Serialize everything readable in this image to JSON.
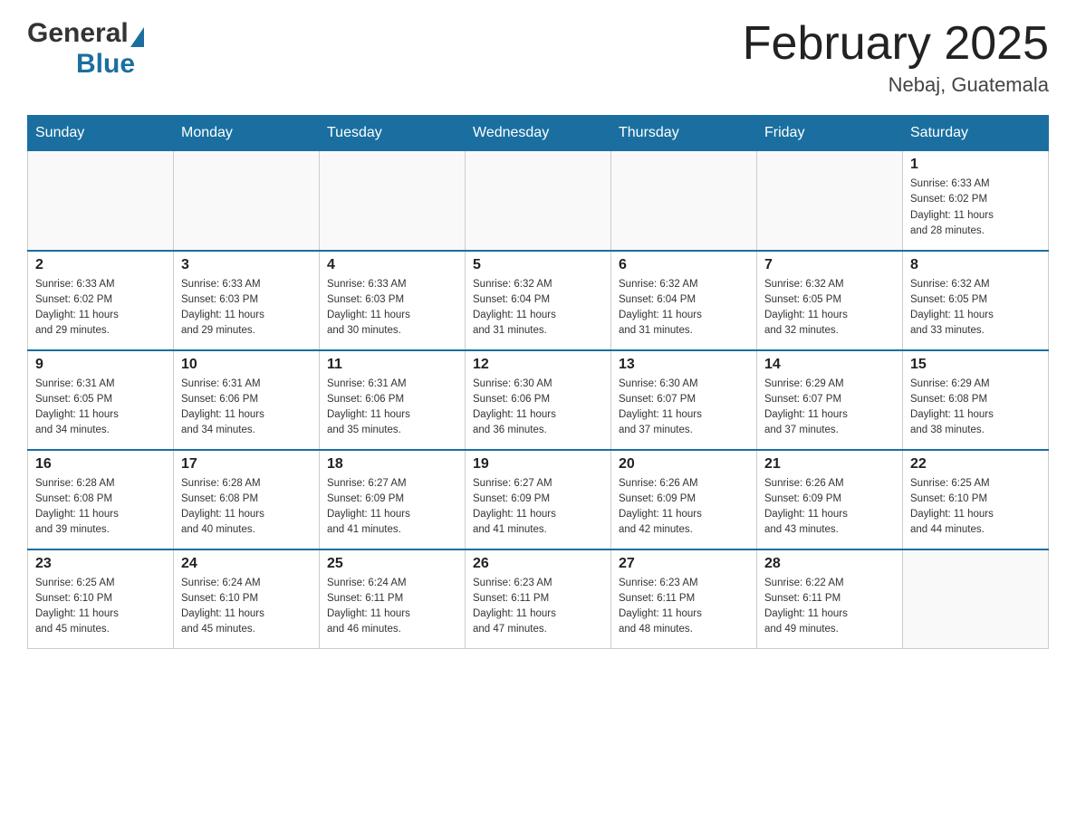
{
  "header": {
    "logo": {
      "general": "General",
      "blue": "Blue"
    },
    "title": "February 2025",
    "location": "Nebaj, Guatemala"
  },
  "calendar": {
    "days_of_week": [
      "Sunday",
      "Monday",
      "Tuesday",
      "Wednesday",
      "Thursday",
      "Friday",
      "Saturday"
    ],
    "weeks": [
      [
        {
          "day": "",
          "info": ""
        },
        {
          "day": "",
          "info": ""
        },
        {
          "day": "",
          "info": ""
        },
        {
          "day": "",
          "info": ""
        },
        {
          "day": "",
          "info": ""
        },
        {
          "day": "",
          "info": ""
        },
        {
          "day": "1",
          "info": "Sunrise: 6:33 AM\nSunset: 6:02 PM\nDaylight: 11 hours\nand 28 minutes."
        }
      ],
      [
        {
          "day": "2",
          "info": "Sunrise: 6:33 AM\nSunset: 6:02 PM\nDaylight: 11 hours\nand 29 minutes."
        },
        {
          "day": "3",
          "info": "Sunrise: 6:33 AM\nSunset: 6:03 PM\nDaylight: 11 hours\nand 29 minutes."
        },
        {
          "day": "4",
          "info": "Sunrise: 6:33 AM\nSunset: 6:03 PM\nDaylight: 11 hours\nand 30 minutes."
        },
        {
          "day": "5",
          "info": "Sunrise: 6:32 AM\nSunset: 6:04 PM\nDaylight: 11 hours\nand 31 minutes."
        },
        {
          "day": "6",
          "info": "Sunrise: 6:32 AM\nSunset: 6:04 PM\nDaylight: 11 hours\nand 31 minutes."
        },
        {
          "day": "7",
          "info": "Sunrise: 6:32 AM\nSunset: 6:05 PM\nDaylight: 11 hours\nand 32 minutes."
        },
        {
          "day": "8",
          "info": "Sunrise: 6:32 AM\nSunset: 6:05 PM\nDaylight: 11 hours\nand 33 minutes."
        }
      ],
      [
        {
          "day": "9",
          "info": "Sunrise: 6:31 AM\nSunset: 6:05 PM\nDaylight: 11 hours\nand 34 minutes."
        },
        {
          "day": "10",
          "info": "Sunrise: 6:31 AM\nSunset: 6:06 PM\nDaylight: 11 hours\nand 34 minutes."
        },
        {
          "day": "11",
          "info": "Sunrise: 6:31 AM\nSunset: 6:06 PM\nDaylight: 11 hours\nand 35 minutes."
        },
        {
          "day": "12",
          "info": "Sunrise: 6:30 AM\nSunset: 6:06 PM\nDaylight: 11 hours\nand 36 minutes."
        },
        {
          "day": "13",
          "info": "Sunrise: 6:30 AM\nSunset: 6:07 PM\nDaylight: 11 hours\nand 37 minutes."
        },
        {
          "day": "14",
          "info": "Sunrise: 6:29 AM\nSunset: 6:07 PM\nDaylight: 11 hours\nand 37 minutes."
        },
        {
          "day": "15",
          "info": "Sunrise: 6:29 AM\nSunset: 6:08 PM\nDaylight: 11 hours\nand 38 minutes."
        }
      ],
      [
        {
          "day": "16",
          "info": "Sunrise: 6:28 AM\nSunset: 6:08 PM\nDaylight: 11 hours\nand 39 minutes."
        },
        {
          "day": "17",
          "info": "Sunrise: 6:28 AM\nSunset: 6:08 PM\nDaylight: 11 hours\nand 40 minutes."
        },
        {
          "day": "18",
          "info": "Sunrise: 6:27 AM\nSunset: 6:09 PM\nDaylight: 11 hours\nand 41 minutes."
        },
        {
          "day": "19",
          "info": "Sunrise: 6:27 AM\nSunset: 6:09 PM\nDaylight: 11 hours\nand 41 minutes."
        },
        {
          "day": "20",
          "info": "Sunrise: 6:26 AM\nSunset: 6:09 PM\nDaylight: 11 hours\nand 42 minutes."
        },
        {
          "day": "21",
          "info": "Sunrise: 6:26 AM\nSunset: 6:09 PM\nDaylight: 11 hours\nand 43 minutes."
        },
        {
          "day": "22",
          "info": "Sunrise: 6:25 AM\nSunset: 6:10 PM\nDaylight: 11 hours\nand 44 minutes."
        }
      ],
      [
        {
          "day": "23",
          "info": "Sunrise: 6:25 AM\nSunset: 6:10 PM\nDaylight: 11 hours\nand 45 minutes."
        },
        {
          "day": "24",
          "info": "Sunrise: 6:24 AM\nSunset: 6:10 PM\nDaylight: 11 hours\nand 45 minutes."
        },
        {
          "day": "25",
          "info": "Sunrise: 6:24 AM\nSunset: 6:11 PM\nDaylight: 11 hours\nand 46 minutes."
        },
        {
          "day": "26",
          "info": "Sunrise: 6:23 AM\nSunset: 6:11 PM\nDaylight: 11 hours\nand 47 minutes."
        },
        {
          "day": "27",
          "info": "Sunrise: 6:23 AM\nSunset: 6:11 PM\nDaylight: 11 hours\nand 48 minutes."
        },
        {
          "day": "28",
          "info": "Sunrise: 6:22 AM\nSunset: 6:11 PM\nDaylight: 11 hours\nand 49 minutes."
        },
        {
          "day": "",
          "info": ""
        }
      ]
    ]
  }
}
